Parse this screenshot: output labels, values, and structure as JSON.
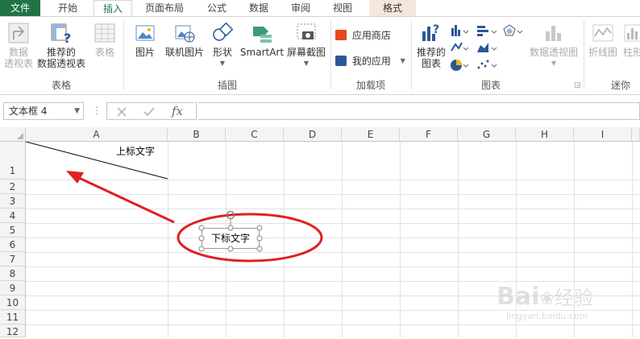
{
  "tabs": [
    "文件",
    "开始",
    "插入",
    "页面布局",
    "公式",
    "数据",
    "审阅",
    "视图",
    "格式"
  ],
  "ribbon": {
    "tables_group": {
      "label": "表格",
      "pivot_table": "数据\n透视表",
      "recommended_pivot": "推荐的\n数据透视表",
      "table": "表格"
    },
    "illustrations_group": {
      "label": "插图",
      "pictures": "图片",
      "online_pictures": "联机图片",
      "shapes": "形状",
      "smartart": "SmartArt",
      "screenshot": "屏幕截图"
    },
    "addins_group": {
      "label": "加载项",
      "store": "应用商店",
      "my_apps": "我的应用"
    },
    "charts_group": {
      "label": "图表",
      "recommended_charts": "推荐的\n图表",
      "pivot_chart": "数据透视图"
    },
    "sparklines_group": {
      "label": "迷你",
      "line": "折线图",
      "column": "柱形"
    }
  },
  "formula_bar": {
    "name_box": "文本框 4",
    "fx": "fx",
    "value": ""
  },
  "grid": {
    "columns": [
      "A",
      "B",
      "C",
      "D",
      "E",
      "F",
      "G",
      "H",
      "I"
    ],
    "rows": [
      "1",
      "2",
      "3",
      "4",
      "5",
      "6",
      "7",
      "8",
      "9",
      "10",
      "11",
      "12"
    ],
    "cell_a1_upper": "上标文字",
    "textbox_text": "下标文字"
  },
  "watermark": {
    "brand": "Bai",
    "brand2": "经验",
    "url": "jingyan.baidu.com"
  },
  "colors": {
    "file_tab": "#217346",
    "annotation": "#e02020",
    "format_tab_bg": "#f6e7dc"
  }
}
